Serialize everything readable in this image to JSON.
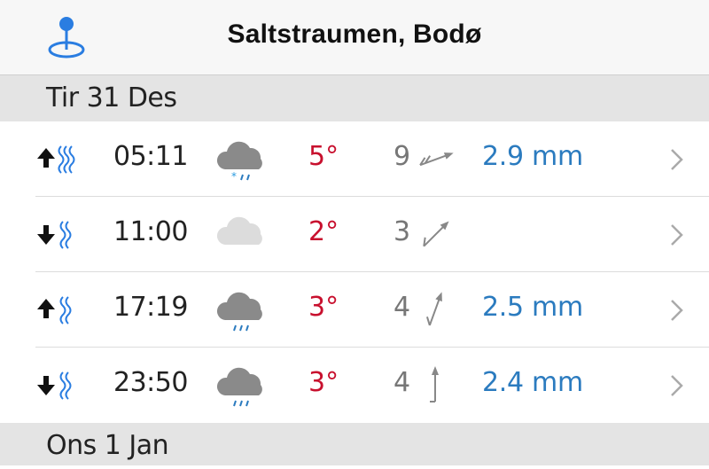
{
  "header": {
    "title": "Saltstraumen, Bodø",
    "location_icon": "location-pin-icon"
  },
  "days": [
    {
      "label": "Tir 31 Des"
    },
    {
      "label": "Ons 1 Jan"
    }
  ],
  "rows": [
    {
      "tide": "high",
      "time": "05:11",
      "weather": "sleet-cloud",
      "temp": "5°",
      "wind": "9",
      "wind_dir_deg": 70,
      "precip": "2.9 mm"
    },
    {
      "tide": "low",
      "time": "11:00",
      "weather": "cloudy-light",
      "temp": "2°",
      "wind": "3",
      "wind_dir_deg": 45,
      "precip": ""
    },
    {
      "tide": "high",
      "time": "17:19",
      "weather": "rain-cloud",
      "temp": "3°",
      "wind": "4",
      "wind_dir_deg": 20,
      "precip": "2.5 mm"
    },
    {
      "tide": "low",
      "time": "23:50",
      "weather": "rain-cloud",
      "temp": "3°",
      "wind": "4",
      "wind_dir_deg": 0,
      "precip": "2.4 mm"
    }
  ],
  "colors": {
    "temp": "#c8102e",
    "precip": "#2b7bbf",
    "accent": "#2a7de1"
  }
}
